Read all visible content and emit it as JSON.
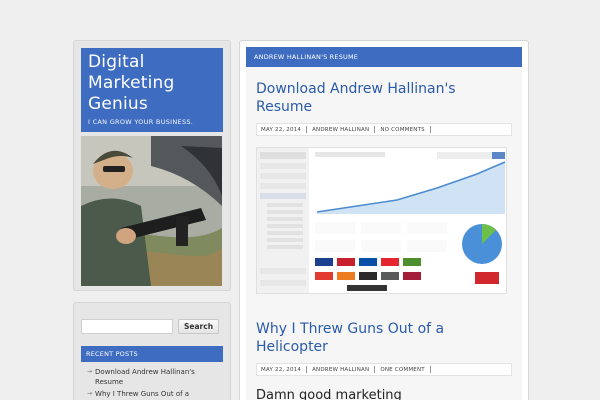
{
  "site": {
    "title": "Digital Marketing Genius",
    "title_lines": [
      "Digital",
      "Marketing",
      "Genius"
    ],
    "tagline": "I CAN GROW YOUR BUSINESS."
  },
  "sidebar": {
    "search_placeholder": "",
    "search_button": "Search",
    "recent_posts_title": "RECENT POSTS",
    "recent_posts": [
      "Download Andrew Hallinan's Resume",
      "Why I Threw Guns Out of a"
    ]
  },
  "main": {
    "banner": "ANDREW HALLINAN'S RESUME",
    "posts": [
      {
        "title": "Download Andrew Hallinan's Resume",
        "date": "MAY 22, 2014",
        "author": "ANDREW HALLINAN",
        "comments": "NO COMMENTS"
      },
      {
        "title": "Why I Threw Guns Out of a Helicopter",
        "date": "MAY 22, 2014",
        "author": "ANDREW HALLINAN",
        "comments": "ONE COMMENT"
      }
    ],
    "excerpt": "Damn good marketing"
  },
  "colors": {
    "accent": "#3d6cc0",
    "link": "#2a5aaa",
    "background": "#efefef"
  }
}
